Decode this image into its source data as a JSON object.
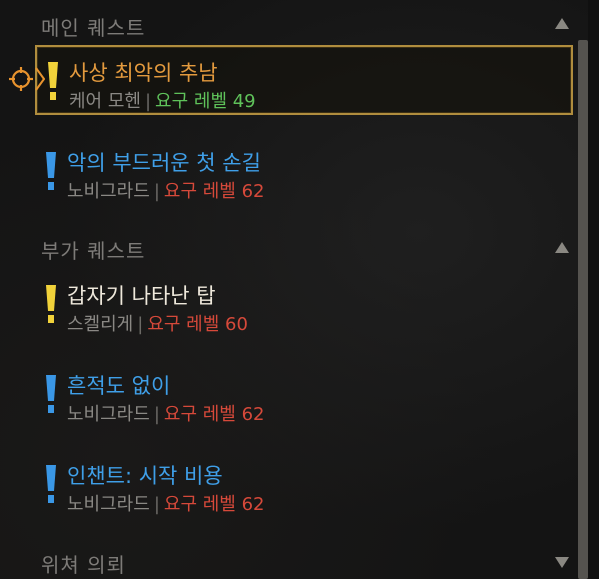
{
  "sections": {
    "main": {
      "label": "메인 퀘스트",
      "arrow": "collapse-up"
    },
    "side": {
      "label": "부가 퀘스트",
      "arrow": "collapse-up"
    },
    "request": {
      "label": "위쳐 의뢰",
      "arrow": "expand-down"
    }
  },
  "quests": [
    {
      "title": "사상 최악의 추남",
      "region": "케어 모헨",
      "level_label": "요구 레벨 49",
      "marker": "gold-exclamation-icon",
      "level_status": "met"
    },
    {
      "title": "악의 부드러운 첫 손길",
      "region": "노비그라드",
      "level_label": "요구 레벨 62",
      "marker": "blue-exclamation-icon",
      "level_status": "unmet"
    },
    {
      "title": "갑자기 나타난 탑",
      "region": "스켈리게",
      "level_label": "요구 레벨 60",
      "marker": "gold-exclamation-icon",
      "level_status": "unmet"
    },
    {
      "title": "흔적도 없이",
      "region": "노비그라드",
      "level_label": "요구 레벨 62",
      "marker": "blue-exclamation-icon",
      "level_status": "unmet"
    },
    {
      "title": "인챈트: 시작 비용",
      "region": "노비그라드",
      "level_label": "요구 레벨 62",
      "marker": "blue-exclamation-icon",
      "level_status": "unmet"
    }
  ],
  "separator": "|",
  "colors": {
    "gold_title": "#e39a3e",
    "blue_title": "#3f9fe8",
    "white_title": "#efe9dc",
    "level_met": "#5fc25a",
    "level_unmet": "#d6493a",
    "selected_border": "#b08d3e"
  },
  "tracked_quest_index": 0
}
